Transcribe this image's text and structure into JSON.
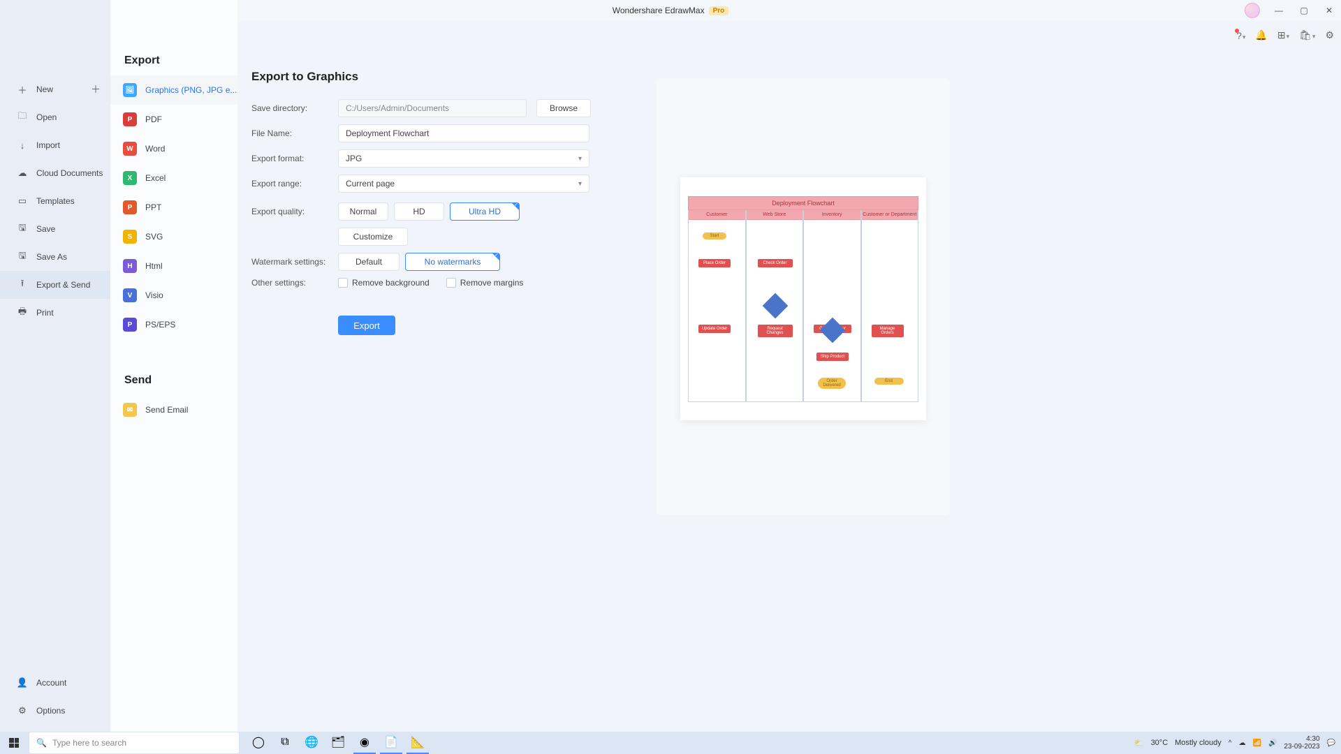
{
  "app": {
    "title": "Wondershare EdrawMax",
    "badge": "Pro"
  },
  "sidebar": {
    "items": [
      {
        "key": "new",
        "label": "New",
        "glyph": "＋",
        "plus": true
      },
      {
        "key": "open",
        "label": "Open",
        "glyph": "🗀"
      },
      {
        "key": "import",
        "label": "Import",
        "glyph": "↓"
      },
      {
        "key": "cloud",
        "label": "Cloud Documents",
        "glyph": "☁"
      },
      {
        "key": "templates",
        "label": "Templates",
        "glyph": "▭"
      },
      {
        "key": "save",
        "label": "Save",
        "glyph": "🖫"
      },
      {
        "key": "saveas",
        "label": "Save As",
        "glyph": "🖫"
      },
      {
        "key": "export",
        "label": "Export & Send",
        "glyph": "⭱",
        "active": true
      },
      {
        "key": "print",
        "label": "Print",
        "glyph": "🖶"
      }
    ],
    "bottom": [
      {
        "key": "account",
        "label": "Account",
        "glyph": "👤"
      },
      {
        "key": "options",
        "label": "Options",
        "glyph": "⚙"
      }
    ]
  },
  "formats": {
    "heading_export": "Export",
    "heading_send": "Send",
    "export_items": [
      {
        "key": "graphics",
        "label": "Graphics (PNG, JPG e...",
        "cls": "ic-img",
        "g": "🖼",
        "active": true
      },
      {
        "key": "pdf",
        "label": "PDF",
        "cls": "ic-pdf",
        "g": "P"
      },
      {
        "key": "word",
        "label": "Word",
        "cls": "ic-word",
        "g": "W"
      },
      {
        "key": "excel",
        "label": "Excel",
        "cls": "ic-excel",
        "g": "X"
      },
      {
        "key": "ppt",
        "label": "PPT",
        "cls": "ic-ppt",
        "g": "P"
      },
      {
        "key": "svg",
        "label": "SVG",
        "cls": "ic-svg",
        "g": "S"
      },
      {
        "key": "html",
        "label": "Html",
        "cls": "ic-html",
        "g": "H"
      },
      {
        "key": "visio",
        "label": "Visio",
        "cls": "ic-visio",
        "g": "V"
      },
      {
        "key": "ps",
        "label": "PS/EPS",
        "cls": "ic-ps",
        "g": "P"
      }
    ],
    "send_items": [
      {
        "key": "email",
        "label": "Send Email",
        "cls": "ic-mail",
        "g": "✉"
      }
    ]
  },
  "form": {
    "title": "Export to Graphics",
    "dir_label": "Save directory:",
    "dir_value": "C:/Users/Admin/Documents",
    "browse": "Browse",
    "fname_label": "File Name:",
    "fname_value": "Deployment Flowchart",
    "format_label": "Export format:",
    "format_value": "JPG",
    "range_label": "Export range:",
    "range_value": "Current page",
    "quality_label": "Export quality:",
    "quality_opts": [
      "Normal",
      "HD",
      "Ultra HD"
    ],
    "quality_selected": "Ultra HD",
    "customize": "Customize",
    "watermark_label": "Watermark settings:",
    "watermark_opts": [
      "Default",
      "No watermarks"
    ],
    "watermark_selected": "No watermarks",
    "other_label": "Other settings:",
    "other_opts": [
      "Remove background",
      "Remove margins"
    ],
    "export_btn": "Export"
  },
  "preview": {
    "title": "Deployment Flowchart",
    "cols": [
      "Customer",
      "Web Store",
      "Inventory",
      "Customer or Department"
    ]
  },
  "taskbar": {
    "search_placeholder": "Type here to search",
    "weather_temp": "30°C",
    "weather_text": "Mostly cloudy",
    "time": "4:30",
    "date": "23-09-2023"
  }
}
